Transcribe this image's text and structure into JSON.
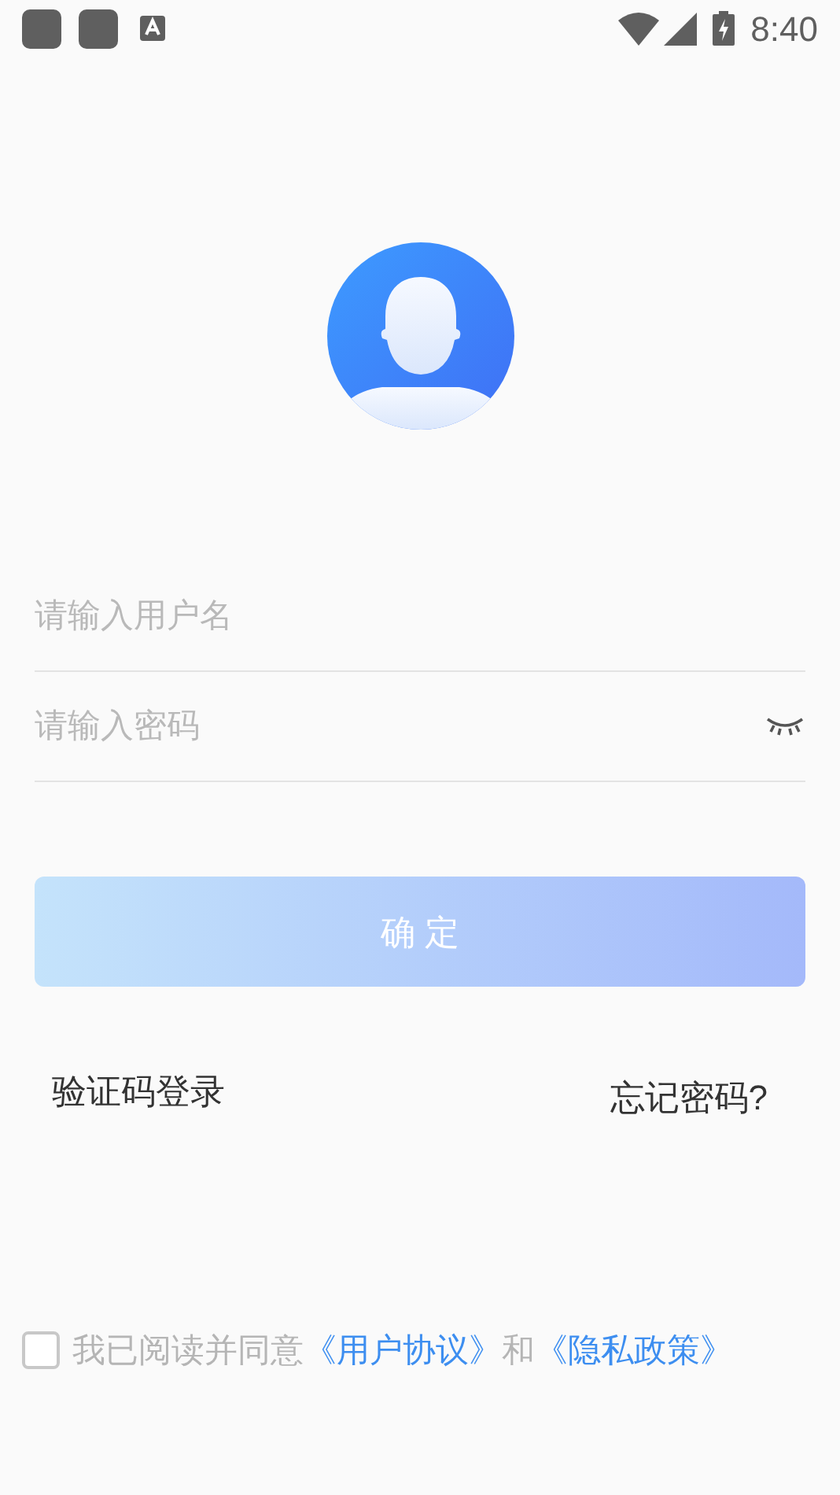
{
  "status_bar": {
    "time": "8:40"
  },
  "username_field": {
    "placeholder": "请输入用户名"
  },
  "password_field": {
    "placeholder": "请输入密码",
    "password_visible": false
  },
  "confirm_button": {
    "label": "确 定",
    "disabled": true
  },
  "links": [
    {
      "label": "验证码登录"
    },
    {
      "label": "忘记密码?"
    }
  ],
  "agreement": {
    "checked": false,
    "text": "我已阅读并同意",
    "link_1": "《用户协议》",
    "joiner": "和",
    "link_2": "《隐私政策》"
  }
}
